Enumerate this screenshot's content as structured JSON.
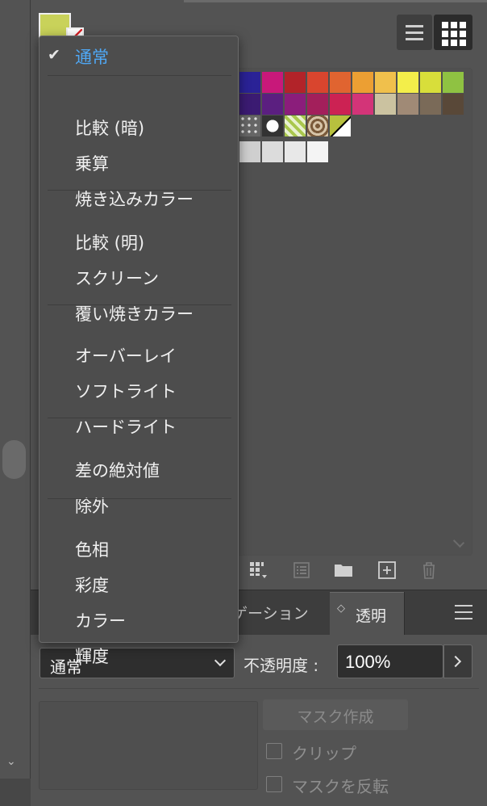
{
  "blend_menu": {
    "selected": "通常",
    "groups": [
      [
        "通常"
      ],
      [
        "比較 (暗)",
        "乗算",
        "焼き込みカラー"
      ],
      [
        "比較 (明)",
        "スクリーン",
        "覆い焼きカラー"
      ],
      [
        "オーバーレイ",
        "ソフトライト",
        "ハードライト"
      ],
      [
        "差の絶対値",
        "除外"
      ],
      [
        "色相",
        "彩度",
        "カラー",
        "輝度"
      ]
    ]
  },
  "swatches_panel": {
    "fill_color": "#c9d25a",
    "view_buttons": [
      "list-view-icon",
      "grid-view-icon"
    ],
    "toolbar_icons": [
      "swatch-library-menu-icon",
      "show-swatch-kinds-icon",
      "new-color-group-icon",
      "new-swatch-icon",
      "delete-swatch-icon"
    ],
    "swatch_rows": [
      [
        "#2a2296",
        "#c8187a",
        "#b22329",
        "#d9452e",
        "#e06430",
        "#ec9f33",
        "#f0c04c",
        "#f3ee4a",
        "#d8de3a",
        "#8fc242"
      ],
      [
        "#3b1b72",
        "#5b1f80",
        "#8b1d7b",
        "#a31f5b",
        "#cc2253",
        "#d33478",
        "#cbc2a0",
        "#a08a76",
        "#7a6a58",
        "#594838"
      ],
      [
        "pattern",
        "pattern-checker",
        "pattern-leaves",
        "pattern-swirl",
        "#b7c03e"
      ],
      [
        "#cfcfcf",
        "#dcdcdc",
        "#e8e8e8",
        "#f4f4f4"
      ]
    ]
  },
  "tabs": {
    "gradation_partial": "ゲーション",
    "transparency": "透明",
    "transparency_arrows": "◇"
  },
  "transparency_panel": {
    "blend_mode_value": "通常",
    "opacity_label": "不透明度 :",
    "opacity_value": "100%",
    "make_mask_label": "マスク作成",
    "clip_label": "クリップ",
    "invert_mask_label": "マスクを反転"
  },
  "left_strip": {
    "chevron": "⌄"
  }
}
